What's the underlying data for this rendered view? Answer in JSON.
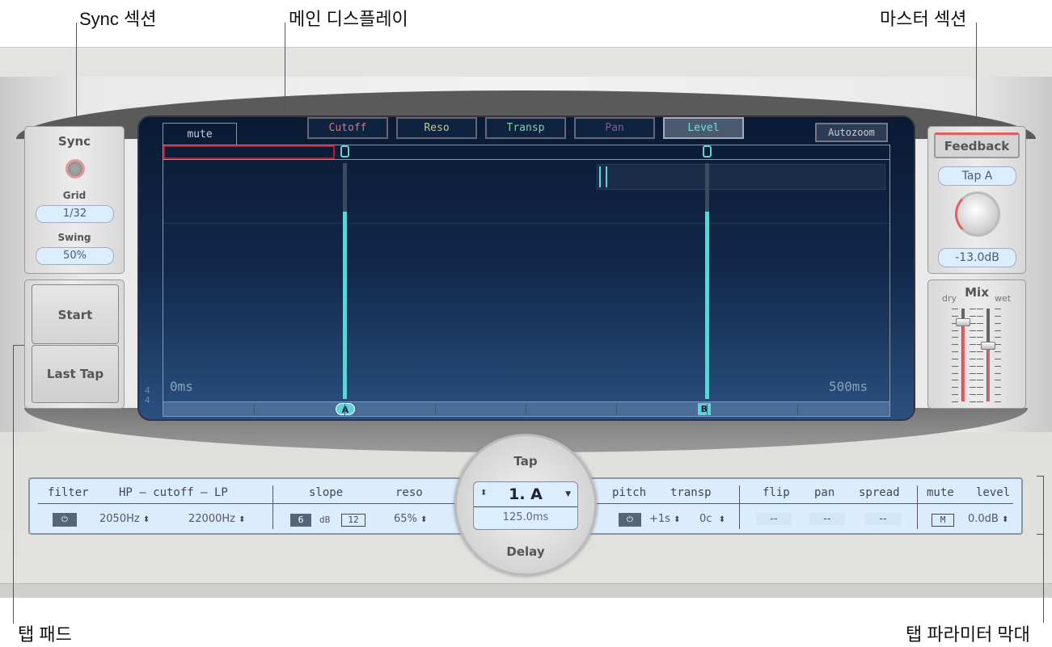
{
  "annotations": {
    "sync": "Sync 섹션",
    "main_display": "메인 디스플레이",
    "master": "마스터 섹션",
    "tap_pad": "탭 패드",
    "tap_param_bar": "탭 파라미터 막대"
  },
  "sync": {
    "title": "Sync",
    "grid_label": "Grid",
    "grid_value": "1/32",
    "swing_label": "Swing",
    "swing_value": "50%"
  },
  "tap_pad": {
    "start": "Start",
    "last_tap": "Last Tap"
  },
  "display": {
    "mute_tab": "mute",
    "view_buttons": [
      "Cutoff",
      "Reso",
      "Transp",
      "Pan",
      "Level"
    ],
    "view_colors": [
      "#d07a80",
      "#c8c880",
      "#80d0a0",
      "#8a5a90",
      "#70e0e0"
    ],
    "selected_view": "Level",
    "autozoom": "Autozoom",
    "time_start": "0ms",
    "time_end": "500ms",
    "time_signature_top": "4",
    "time_signature_bottom": "4",
    "taps": [
      {
        "label": "A",
        "delay_ms": 125,
        "level_fraction": 0.8
      },
      {
        "label": "B",
        "delay_ms": 375,
        "level_fraction": 0.8
      }
    ],
    "mute_marker": "0",
    "accent": "#5fd4d8"
  },
  "master": {
    "feedback": "Feedback",
    "feedback_source": "Tap A",
    "feedback_level": "-13.0dB",
    "mix_label": "Mix",
    "dry": "dry",
    "wet": "wet",
    "dry_fraction": 0.85,
    "wet_fraction": 0.6
  },
  "tap": {
    "title": "Tap",
    "selected": "1. A",
    "delay_value": "125.0ms",
    "delay_label": "Delay"
  },
  "params": {
    "filter": "filter",
    "cutoff": "HP – cutoff – LP",
    "hp_value": "2050Hz",
    "lp_value": "22000Hz",
    "slope": "slope",
    "slope_6": "6",
    "slope_db": "dB",
    "slope_12": "12",
    "reso": "reso",
    "reso_value": "65%",
    "pitch": "pitch",
    "transp": "transp",
    "transp_s": "+1s",
    "transp_c": "0c",
    "flip": "flip",
    "pan": "pan",
    "spread": "spread",
    "flip_value": "--",
    "pan_value": "--",
    "spread_value": "--",
    "mute": "mute",
    "mute_btn": "M",
    "level": "level",
    "level_value": "0.0dB",
    "power_icon": "⏻"
  }
}
